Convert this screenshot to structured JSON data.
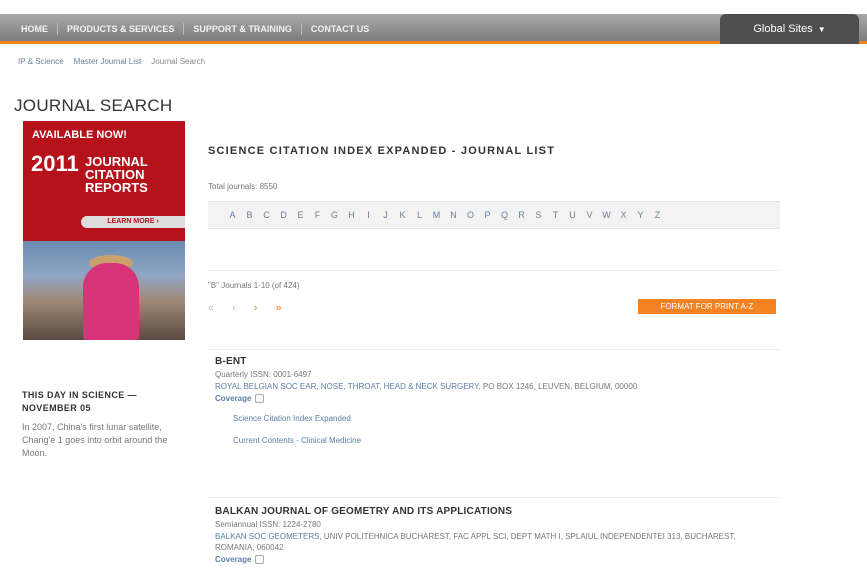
{
  "nav": {
    "links": [
      "HOME",
      "PRODUCTS & SERVICES",
      "SUPPORT & TRAINING",
      "CONTACT US"
    ],
    "global_sites": "Global Sites"
  },
  "breadcrumb": {
    "items": [
      "IP & Science",
      "Master Journal List"
    ],
    "current": "Journal Search"
  },
  "page_title": "JOURNAL SEARCH",
  "ad": {
    "headline": "AVAILABLE NOW!",
    "year": "2011",
    "product": "JOURNAL CITATION REPORTS",
    "cta": "LEARN MORE ›"
  },
  "this_day": {
    "title": "THIS DAY IN SCIENCE — NOVEMBER 05",
    "text": "In 2007, China's first lunar satellite, Chang'e 1 goes into orbit around the Moon."
  },
  "list": {
    "title": "SCIENCE CITATION INDEX EXPANDED - JOURNAL LIST",
    "total": "Total journals: 8550",
    "letters": [
      "A",
      "B",
      "C",
      "D",
      "E",
      "F",
      "G",
      "H",
      "I",
      "J",
      "K",
      "L",
      "M",
      "N",
      "O",
      "P",
      "Q",
      "R",
      "S",
      "T",
      "U",
      "V",
      "W",
      "X",
      "Y",
      "Z"
    ],
    "range": "\"B\" Journals 1-10 (of 424)",
    "pager": {
      "first": "«",
      "prev": "‹",
      "next": "›",
      "last": "»"
    },
    "format_button": "FORMAT FOR PRINT A-Z"
  },
  "journals": [
    {
      "title": "B-ENT",
      "frequency": "Quarterly ISSN: 0001-6497",
      "publisher_link": "ROYAL BELGIAN SOC EAR, NOSE, THROAT, HEAD & NECK SURGERY",
      "publisher_rest": ", PO BOX 1246, LEUVEN, BELGIUM, 00000",
      "coverage_label": "Coverage",
      "indexes": [
        "Science Citation Index Expanded",
        "Current Contents - Clinical Medicine"
      ]
    },
    {
      "title": "BALKAN JOURNAL OF GEOMETRY AND ITS APPLICATIONS",
      "frequency": "Semiannual ISSN: 1224-2780",
      "publisher_link": "BALKAN SOC GEOMETERS",
      "publisher_rest": ", UNIV POLITEHNICA BUCHAREST, FAC APPL SCI, DEPT MATH I, SPLAIUL INDEPENDENTEI 313, BUCHAREST, ROMANIA, 060042",
      "coverage_label": "Coverage",
      "indexes": []
    }
  ],
  "colors": {
    "accent": "#f58220",
    "ad_red": "#b5121b",
    "link": "#5d7ea5"
  }
}
